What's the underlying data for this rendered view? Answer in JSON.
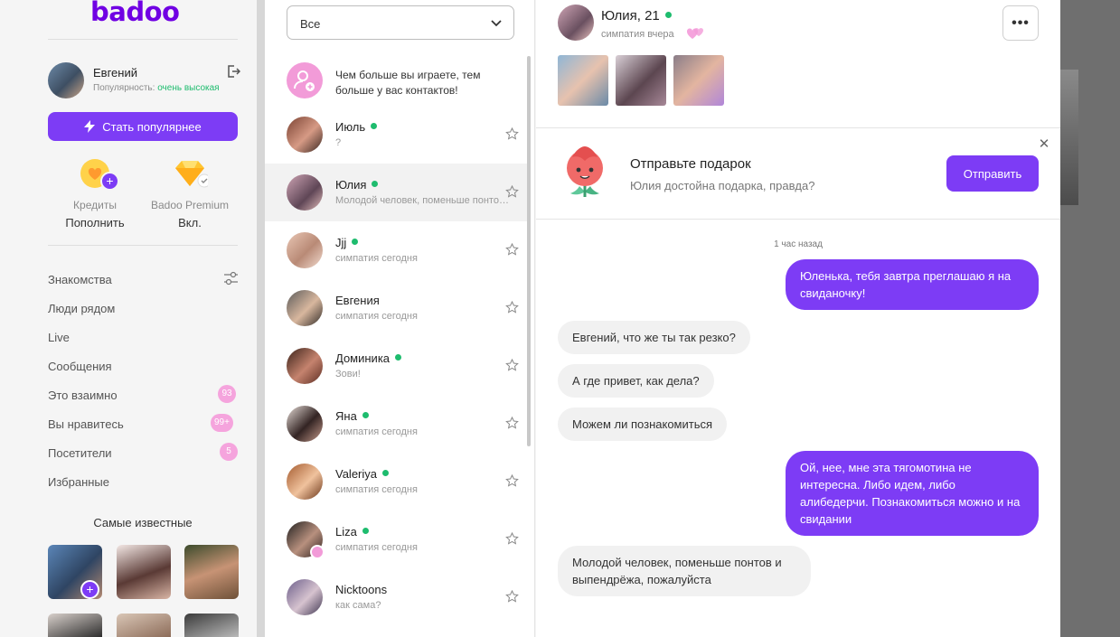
{
  "brand": {
    "logo": "badoo",
    "accent": "#7d3cf5",
    "online": "#1ebc6e"
  },
  "profile": {
    "name": "Евгений",
    "popularity_label": "Популярность:",
    "popularity_value": "очень высокая"
  },
  "promote_button": "Стать популярнее",
  "features": [
    {
      "label": "Кредиты",
      "value": "Пополнить"
    },
    {
      "label": "Badoo Premium",
      "value": "Вкл."
    }
  ],
  "nav": [
    {
      "label": "Знакомства"
    },
    {
      "label": "Люди рядом"
    },
    {
      "label": "Live"
    },
    {
      "label": "Сообщения"
    },
    {
      "label": "Это взаимно",
      "badge": "93"
    },
    {
      "label": "Вы нравитесь",
      "badge": "99+"
    },
    {
      "label": "Посетители",
      "badge": "5"
    },
    {
      "label": "Избранные"
    }
  ],
  "famous_title": "Самые известные",
  "conversations": {
    "filter": "Все",
    "invite_text": "Чем больше вы играете, тем больше у вас контактов!",
    "items": [
      {
        "name": "Июль",
        "online": true,
        "sub": "?"
      },
      {
        "name": "Юлия",
        "online": true,
        "sub": "Молодой человек, поменьше понтов и выпендрёжа, пожалуйста",
        "active": true
      },
      {
        "name": "Jjj",
        "online": true,
        "sub": "симпатия сегодня"
      },
      {
        "name": "Евгения",
        "online": false,
        "sub": "симпатия сегодня"
      },
      {
        "name": "Доминика",
        "online": true,
        "sub": "Зови!"
      },
      {
        "name": "Яна",
        "online": true,
        "sub": "симпатия сегодня"
      },
      {
        "name": "Valeriya",
        "online": true,
        "sub": "симпатия сегодня"
      },
      {
        "name": "Liza",
        "online": true,
        "sub": "симпатия сегодня"
      },
      {
        "name": "Nicktoons",
        "online": false,
        "sub": "как сама?"
      }
    ]
  },
  "chat": {
    "name": "Юлия, 21",
    "sub": "симпатия вчера",
    "gift_title": "Отправьте подарок",
    "gift_sub": "Юлия достойна подарка, правда?",
    "gift_button": "Отправить",
    "timestamp": "1 час назад",
    "messages": [
      {
        "dir": "out",
        "text": "Юленька, тебя завтра преглашаю я на свиданочку!"
      },
      {
        "dir": "in",
        "text": "Евгений, что же ты так резко?"
      },
      {
        "dir": "in",
        "text": "А где привет, как дела?"
      },
      {
        "dir": "in",
        "text": "Можем ли познакомиться"
      },
      {
        "dir": "out",
        "text": "Ой, нее, мне эта тягомотина не интересна. Либо идем, либо алибедерчи. Познакомиться можно и на свидании"
      },
      {
        "dir": "in",
        "text": "Молодой человек, поменьше понтов и выпендрёжа, пожалуйста"
      }
    ]
  }
}
